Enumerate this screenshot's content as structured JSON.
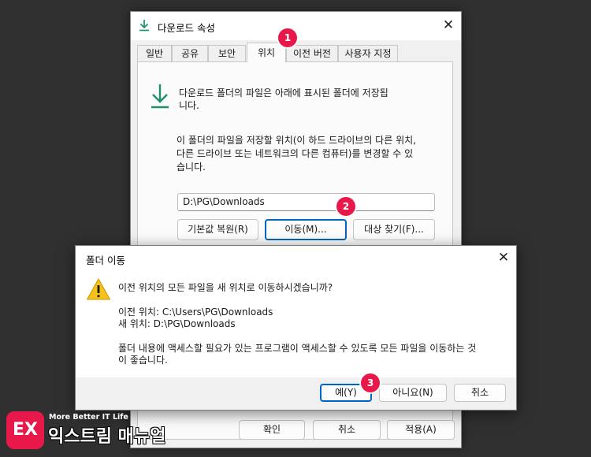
{
  "properties_window": {
    "title": "다운로드 속성",
    "tabs": [
      {
        "label": "일반"
      },
      {
        "label": "공유"
      },
      {
        "label": "보안"
      },
      {
        "label": "위치",
        "active": true
      },
      {
        "label": "이전 버전"
      },
      {
        "label": "사용자 지정"
      }
    ],
    "info_text_line1": "다운로드 폴더의 파일은 아래에 표시된 폴더에 저장됩",
    "info_text_line2": "니다.",
    "desc_line1": "이 폴더의 파일을 저장할 위치(이 하드 드라이브의 다른 위치,",
    "desc_line2": "다른 드라이브 또는 네트워크의 다른 컴퓨터)를 변경할 수 있",
    "desc_line3": "습니다.",
    "path_value": "D:\\PG\\Downloads",
    "buttons": {
      "restore": "기본값 복원(R)",
      "move": "이동(M)...",
      "find_target": "대상 찾기(F)..."
    },
    "footer_buttons": {
      "ok": "확인",
      "cancel": "취소",
      "apply": "적용(A)"
    }
  },
  "move_dialog": {
    "title": "폴더 이동",
    "question": "이전 위치의 모든 파일을 새 위치로 이동하시겠습니까?",
    "old_location": "이전 위치: C:\\Users\\PG\\Downloads",
    "new_location": "새 위치: D:\\PG\\Downloads",
    "note_line1": "폴더 내용에 액세스할 필요가 있는 프로그램이 액세스할 수 있도록 모든 파일을 이동하는 것",
    "note_line2": "이 좋습니다.",
    "buttons": {
      "yes": "예(Y)",
      "no": "아니요(N)",
      "cancel": "취소"
    }
  },
  "badges": [
    "1",
    "2",
    "3"
  ],
  "brand": {
    "logo_letters": "EX",
    "tagline": "More Better IT Life",
    "name": "익스트림 매뉴얼"
  },
  "colors": {
    "accent": "#0067c0",
    "badge": "#e8194a",
    "download_icon": "#1e8f6a",
    "warning": "#f4c21b"
  },
  "icons": {
    "title_icon": "download-arrow-icon",
    "info_icon": "download-arrow-icon",
    "dialog_icon": "warning-icon",
    "close": "close-icon"
  }
}
